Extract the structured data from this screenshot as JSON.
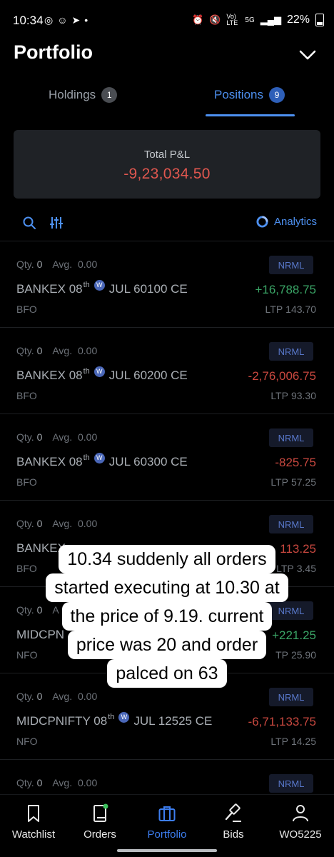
{
  "status_bar": {
    "time": "10:34",
    "left_icons": [
      "whatsapp-icon",
      "snapchat-icon",
      "telegram-icon",
      "dot-icon"
    ],
    "network": "5G",
    "volte": "Vo) LTE",
    "battery": "22%"
  },
  "header": {
    "title": "Portfolio"
  },
  "tabs": [
    {
      "label": "Holdings",
      "count": "1"
    },
    {
      "label": "Positions",
      "count": "9"
    }
  ],
  "summary": {
    "label": "Total P&L",
    "value": "-9,23,034.50"
  },
  "toolbar": {
    "analytics_label": "Analytics"
  },
  "positions": [
    {
      "qty_label": "Qty.",
      "qty": "0",
      "avg_label": "Avg.",
      "avg": "0.00",
      "product": "NRML",
      "symbol": "BANKEX 08",
      "suffix": "th",
      "weekly": "W",
      "contract": "JUL 60100 CE",
      "pnl": "+16,788.75",
      "exchange": "BFO",
      "ltp_label": "LTP",
      "ltp": "143.70"
    },
    {
      "qty_label": "Qty.",
      "qty": "0",
      "avg_label": "Avg.",
      "avg": "0.00",
      "product": "NRML",
      "symbol": "BANKEX 08",
      "suffix": "th",
      "weekly": "W",
      "contract": "JUL 60200 CE",
      "pnl": "-2,76,006.75",
      "exchange": "BFO",
      "ltp_label": "LTP",
      "ltp": "93.30"
    },
    {
      "qty_label": "Qty.",
      "qty": "0",
      "avg_label": "Avg.",
      "avg": "0.00",
      "product": "NRML",
      "symbol": "BANKEX 08",
      "suffix": "th",
      "weekly": "W",
      "contract": "JUL 60300 CE",
      "pnl": "-825.75",
      "exchange": "BFO",
      "ltp_label": "LTP",
      "ltp": "57.25"
    },
    {
      "qty_label": "Qty.",
      "qty": "0",
      "avg_label": "Avg.",
      "avg": "0.00",
      "product": "NRML",
      "symbol": "BANKEX",
      "suffix": "",
      "weekly": "",
      "contract": "",
      "pnl": "113.25",
      "exchange": "BFO",
      "ltp_label": "LTP",
      "ltp": "3.45"
    },
    {
      "qty_label": "Qty.",
      "qty": "0",
      "avg_label": "A",
      "avg": "",
      "product": "NRML",
      "symbol": "MIDCPN",
      "suffix": "",
      "weekly": "",
      "contract": "",
      "pnl": "+221.25",
      "exchange": "NFO",
      "ltp_label": "TP",
      "ltp": "25.90"
    },
    {
      "qty_label": "Qty.",
      "qty": "0",
      "avg_label": "Avg.",
      "avg": "0.00",
      "product": "NRML",
      "symbol": "MIDCPNIFTY 08",
      "suffix": "th",
      "weekly": "W",
      "contract": "JUL 12525 CE",
      "pnl": "-6,71,133.75",
      "exchange": "NFO",
      "ltp_label": "LTP",
      "ltp": "14.25"
    },
    {
      "qty_label": "Qty.",
      "qty": "0",
      "avg_label": "Avg.",
      "avg": "0.00",
      "product": "NRML",
      "symbol": "",
      "suffix": "",
      "weekly": "",
      "contract": "",
      "pnl": "",
      "exchange": "",
      "ltp_label": "",
      "ltp": ""
    }
  ],
  "caption": {
    "lines": [
      "10.34 suddenly all orders",
      "started executing at 10.30 at",
      "the price of 9.19. current",
      "price was 20 and order",
      "palced on 63"
    ]
  },
  "bottom_nav": [
    {
      "label": "Watchlist",
      "icon": "bookmark-icon"
    },
    {
      "label": "Orders",
      "icon": "book-icon"
    },
    {
      "label": "Portfolio",
      "icon": "briefcase-icon"
    },
    {
      "label": "Bids",
      "icon": "gavel-icon"
    },
    {
      "label": "WO5225",
      "icon": "user-icon"
    }
  ],
  "colors": {
    "accent": "#4d90f0",
    "loss": "#c9483f",
    "profit": "#3aa566",
    "background": "#000000",
    "card": "#1f2226"
  }
}
